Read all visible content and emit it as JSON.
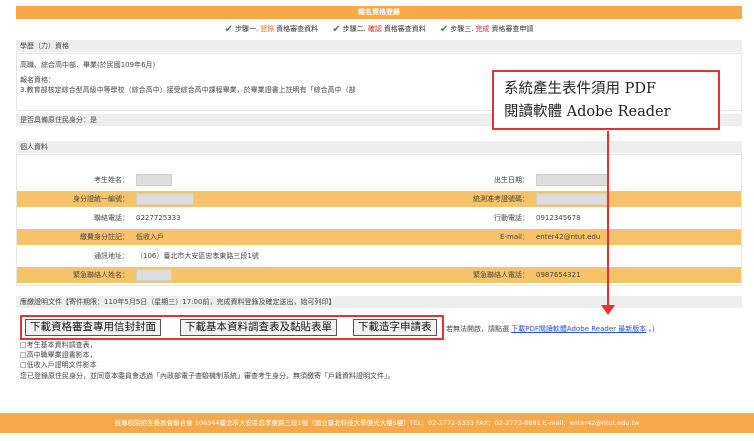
{
  "page": {
    "title": "報名資格登錄",
    "steps": [
      {
        "prefix": "步驟一.",
        "highlight": "登錄",
        "suffix": "資格審查資料",
        "color": "#e8771e"
      },
      {
        "prefix": "步驟二.",
        "highlight": "確認",
        "suffix": "資格審查資料",
        "color": "#d12b2b"
      },
      {
        "prefix": "步驟三.",
        "highlight": "完成",
        "suffix": "資格審查申請",
        "color": "#d12b2b"
      }
    ]
  },
  "qualification": {
    "header": "學歷（力）資格",
    "line1": "高職、綜合高中部．畢業(於民國109年6月)",
    "line2": "報名資格：",
    "line3": "3.教育部核定綜合型高級中等學校（綜合高中）接受綜合高中課程畢業，於畢業證書上註明有「綜合高中（部"
  },
  "indigenous": {
    "header": "是否具備原住民身分：是"
  },
  "personal": {
    "header": "個人資料",
    "rows": [
      {
        "l1": "考生姓名：",
        "v1": "",
        "l2": "出生日期：",
        "v2": "",
        "alt": false
      },
      {
        "l1": "身分證統一編號：",
        "v1": "",
        "l2": "統測准考證號碼：",
        "v2": "",
        "alt": true
      },
      {
        "l1": "聯絡電話：",
        "v1": "0227725333",
        "l2": "行動電話：",
        "v2": "0912345678",
        "alt": false
      },
      {
        "l1": "繳費身分註記：",
        "v1": "低收入戶",
        "l2": "E-mail：",
        "v2": "enter42@ntut.edu",
        "alt": true
      },
      {
        "l1": "通訊地址：",
        "v1": "（106）臺北市大安區忠孝東路三段1號",
        "l2": "",
        "v2": "",
        "alt": false
      },
      {
        "l1": "緊急聯絡人姓名：",
        "v1": "",
        "l2": "緊急聯絡人電話：",
        "v2": "0987654321",
        "alt": true
      }
    ]
  },
  "documents": {
    "header": "應繳證明文件【寄件期限：110年5月5日（星期三）17:00前，完成資料登錄及確定送出，始可列印】",
    "buttons": [
      "下載資格審查專用信封封面",
      "下載基本資料調查表及黏貼表單",
      "下載造字申請表"
    ],
    "notice_pre": "若無法開啟，請點選",
    "notice_link": "下載PDF閱讀軟體Adobe Reader 最新版本",
    "notice_post": "。）",
    "items": [
      "□考生基本資料調查表，",
      "□高中職畢業證書影本，",
      "□低收入戶證明文件影本"
    ],
    "note": "您已登錄原住民身分，並同意本委員會透過「內政部電子查驗機制系統」審查考生身分，無須繳寄「戶籍資料證明文件」。"
  },
  "callout": {
    "line1": "系統產生表件須用 PDF",
    "line2": "閱讀軟體 Adobe Reader"
  },
  "footer": {
    "text": "技專校院招生委員會聯合會 106344臺北市大安區忠孝東路三段1號（國立臺北科技大學億光大樓5樓）TEL：02-2772-5333 FAX：02-2773-8881 E-mail：enter42@ntut.edu.tw"
  },
  "colors": {
    "accent": "#f5a94a",
    "callout": "#e43131",
    "link": "#2a4fd6"
  }
}
